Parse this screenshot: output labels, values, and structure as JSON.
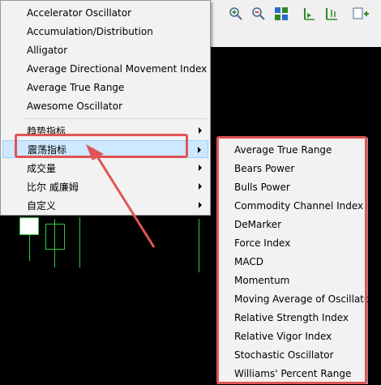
{
  "main_menu": {
    "items": [
      {
        "label": "Accelerator Oscillator",
        "submenu": false
      },
      {
        "label": "Accumulation/Distribution",
        "submenu": false
      },
      {
        "label": "Alligator",
        "submenu": false
      },
      {
        "label": "Average Directional Movement Index",
        "submenu": false
      },
      {
        "label": "Average True Range",
        "submenu": false
      },
      {
        "label": "Awesome Oscillator",
        "submenu": false
      }
    ],
    "categories": [
      {
        "label": "趋势指标",
        "submenu": true
      },
      {
        "label": "震荡指标",
        "submenu": true,
        "highlighted": true
      },
      {
        "label": "成交量",
        "submenu": true
      },
      {
        "label": "比尔 威廉姆",
        "submenu": true
      },
      {
        "label": "自定义",
        "submenu": true
      }
    ]
  },
  "oscillators_submenu": {
    "items": [
      "Average True Range",
      "Bears Power",
      "Bulls Power",
      "Commodity Channel Index",
      "DeMarker",
      "Force Index",
      "MACD",
      "Momentum",
      "Moving Average of Oscillator",
      "Relative Strength Index",
      "Relative Vigor Index",
      "Stochastic Oscillator",
      "Williams' Percent Range"
    ]
  },
  "toolbar": {
    "icons": [
      "zoom-in-icon",
      "zoom-out-icon",
      "grid-icon",
      "period-separator-icon",
      "autoscroll-icon",
      "add-indicator-icon"
    ]
  },
  "colors": {
    "highlight": "#cde8ff",
    "annotation_red": "#e05555",
    "candle_green": "#2ecc40"
  }
}
